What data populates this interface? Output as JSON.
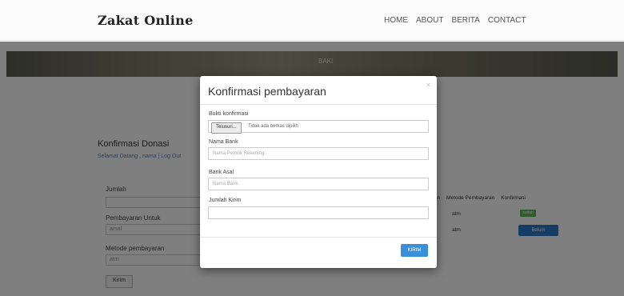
{
  "brand": "Zakat Online",
  "nav": [
    "HOME",
    "ABOUT",
    "BERITA",
    "CONTACT"
  ],
  "hero_text": "BAKI",
  "content": {
    "title": "Konfirmasi Donasi",
    "subtitle": "Selamat Datang , nama | Log Out",
    "jumlah_label": "Jumlah",
    "pembayaran_label": "Pembayaran Untuk",
    "pembayaran_value": "amal",
    "metode_label": "Metode pembayaran",
    "metode_value": "atm",
    "submit_label": "Kirim",
    "table_headers": [
      "an",
      "Metode Pembayaran",
      "Konfirmasi"
    ],
    "rows": [
      {
        "metode": "atm",
        "badge": "sudah"
      },
      {
        "metode": "atm",
        "button": "Belum"
      }
    ]
  },
  "modal": {
    "title": "Konfirmasi pembayaran",
    "close": "×",
    "bukti_label": "Bukti konfirmasi",
    "file_button": "Telusuri...",
    "file_text": "Tidak ada berkas dipilih",
    "nama_bank_label": "Nama Bank",
    "nama_bank_placeholder": "Nama Pemilik Rekening",
    "bank_asal_label": "Bank Asal",
    "bank_asal_placeholder": "Nama Bank",
    "jumlah_kirim_label": "Jumlah Kirim",
    "jumlah_kirim_placeholder": "",
    "send_button": "KIRIM"
  },
  "colors": {
    "primary": "#3a8fd9",
    "success": "#5cb85c",
    "backdrop": "rgba(0,0,0,0.5)"
  }
}
